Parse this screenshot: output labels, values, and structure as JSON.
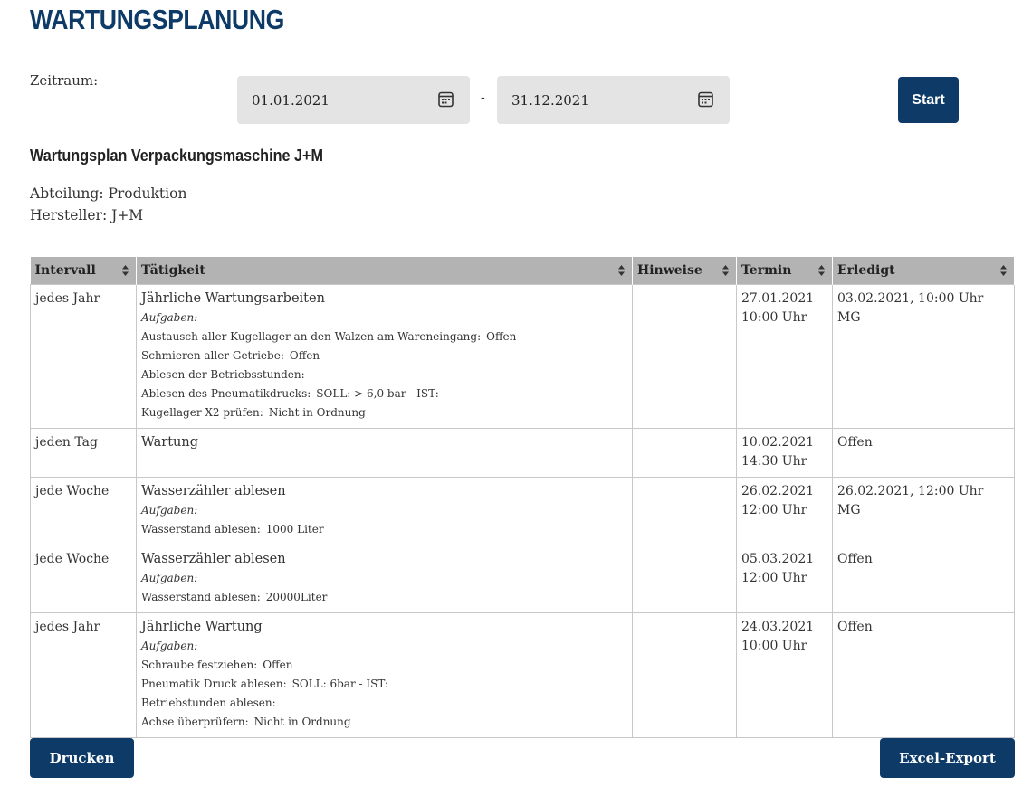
{
  "page": {
    "title": "WARTUNGSPLANUNG"
  },
  "filter": {
    "period_label": "Zeitraum:",
    "from_date": "01.01.2021",
    "separator": "-",
    "to_date": "31.12.2021",
    "start_label": "Start"
  },
  "plan": {
    "title": "Wartungsplan Verpackungsmaschine J+M",
    "department": "Abteilung: Produktion",
    "manufacturer": "Hersteller: J+M"
  },
  "table": {
    "columns": [
      "Intervall",
      "Tätigkeit",
      "Hinweise",
      "Termin",
      "Erledigt"
    ],
    "rows": [
      {
        "interval": "jedes Jahr",
        "task": "Jährliche Wartungsarbeiten",
        "tasks_heading": "Aufgaben:",
        "subtasks": [
          {
            "label": "Austausch aller Kugellager an den Walzen am Wareneingang:",
            "value": "Offen"
          },
          {
            "label": "Schmieren aller Getriebe:",
            "value": "Offen"
          },
          {
            "label": "Ablesen der Betriebsstunden:",
            "value": ""
          },
          {
            "label": "Ablesen des Pneumatikdrucks:",
            "value": "SOLL: > 6,0 bar - IST:"
          },
          {
            "label": "Kugellager X2 prüfen:",
            "value": "Nicht in Ordnung"
          }
        ],
        "notes": "",
        "due_date": "27.01.2021",
        "due_time": "10:00 Uhr",
        "done": "03.02.2021, 10:00 Uhr",
        "done_by": "MG"
      },
      {
        "interval": "jeden Tag",
        "task": "Wartung",
        "tasks_heading": "",
        "subtasks": [],
        "notes": "",
        "due_date": "10.02.2021",
        "due_time": "14:30 Uhr",
        "done": "Offen",
        "done_by": ""
      },
      {
        "interval": "jede Woche",
        "task": "Wasserzähler ablesen",
        "tasks_heading": "Aufgaben:",
        "subtasks": [
          {
            "label": "Wasserstand ablesen:",
            "value": "1000 Liter"
          }
        ],
        "notes": "",
        "due_date": "26.02.2021",
        "due_time": "12:00 Uhr",
        "done": "26.02.2021, 12:00 Uhr",
        "done_by": "MG"
      },
      {
        "interval": "jede Woche",
        "task": "Wasserzähler ablesen",
        "tasks_heading": "Aufgaben:",
        "subtasks": [
          {
            "label": "Wasserstand ablesen:",
            "value": "20000Liter"
          }
        ],
        "notes": "",
        "due_date": "05.03.2021",
        "due_time": "12:00 Uhr",
        "done": "Offen",
        "done_by": ""
      },
      {
        "interval": "jedes Jahr",
        "task": "Jährliche Wartung",
        "tasks_heading": "Aufgaben:",
        "subtasks": [
          {
            "label": "Schraube festziehen:",
            "value": "Offen"
          },
          {
            "label": "Pneumatik Druck ablesen:",
            "value": "SOLL: 6bar - IST:"
          },
          {
            "label": "Betriebstunden ablesen:",
            "value": ""
          },
          {
            "label": "Achse überprüfern:",
            "value": "Nicht in Ordnung"
          }
        ],
        "notes": "",
        "due_date": "24.03.2021",
        "due_time": "10:00 Uhr",
        "done": "Offen",
        "done_by": ""
      }
    ]
  },
  "actions": {
    "print_label": "Drucken",
    "export_label": "Excel-Export"
  },
  "colors": {
    "brand": "#0d3a66",
    "input_bg": "#e4e4e4",
    "table_header_bg": "#b3b3b3"
  },
  "icons": {
    "date_picker": "calendar-icon",
    "sort": "sort-icon"
  }
}
